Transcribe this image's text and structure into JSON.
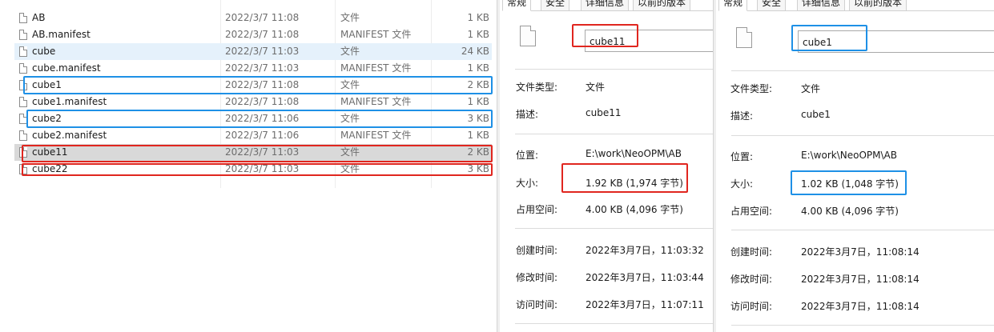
{
  "files": [
    {
      "name": "AB",
      "date": "2022/3/7 11:08",
      "type": "文件",
      "size": "1 KB"
    },
    {
      "name": "AB.manifest",
      "date": "2022/3/7 11:08",
      "type": "MANIFEST 文件",
      "size": "1 KB"
    },
    {
      "name": "cube",
      "date": "2022/3/7 11:03",
      "type": "文件",
      "size": "24 KB"
    },
    {
      "name": "cube.manifest",
      "date": "2022/3/7 11:03",
      "type": "MANIFEST 文件",
      "size": "1 KB"
    },
    {
      "name": "cube1",
      "date": "2022/3/7 11:08",
      "type": "文件",
      "size": "2 KB"
    },
    {
      "name": "cube1.manifest",
      "date": "2022/3/7 11:08",
      "type": "MANIFEST 文件",
      "size": "1 KB"
    },
    {
      "name": "cube2",
      "date": "2022/3/7 11:06",
      "type": "文件",
      "size": "3 KB"
    },
    {
      "name": "cube2.manifest",
      "date": "2022/3/7 11:06",
      "type": "MANIFEST 文件",
      "size": "1 KB"
    },
    {
      "name": "cube11",
      "date": "2022/3/7 11:03",
      "type": "文件",
      "size": "2 KB"
    },
    {
      "name": "cube22",
      "date": "2022/3/7 11:03",
      "type": "文件",
      "size": "3 KB"
    }
  ],
  "tabs": [
    "常规",
    "安全",
    "详细信息",
    "以前的版本"
  ],
  "labels": {
    "type": "文件类型:",
    "desc": "描述:",
    "location": "位置:",
    "size": "大小:",
    "disk_size": "占用空间:",
    "created": "创建时间:",
    "modified": "修改时间:",
    "accessed": "访问时间:"
  },
  "panels": [
    {
      "name": "cube11",
      "file_type": "文件",
      "description": "cube11",
      "location": "E:\\work\\NeoOPM\\AB",
      "size": "1.92 KB (1,974 字节)",
      "disk_size": "4.00 KB (4,096 字节)",
      "created": "2022年3月7日，11:03:32",
      "modified": "2022年3月7日，11:03:44",
      "accessed": "2022年3月7日，11:07:11"
    },
    {
      "name": "cube1",
      "file_type": "文件",
      "description": "cube1",
      "location": "E:\\work\\NeoOPM\\AB",
      "size": "1.02 KB (1,048 字节)",
      "disk_size": "4.00 KB (4,096 字节)",
      "created": "2022年3月7日，11:08:14",
      "modified": "2022年3月7日，11:08:14",
      "accessed": "2022年3月7日，11:08:14"
    }
  ],
  "colors": {
    "highlight_blue": "#1e90e6",
    "highlight_red": "#e0261f",
    "row_light_select": "#e5f1fb",
    "row_grey_select": "#d9d9d9"
  }
}
